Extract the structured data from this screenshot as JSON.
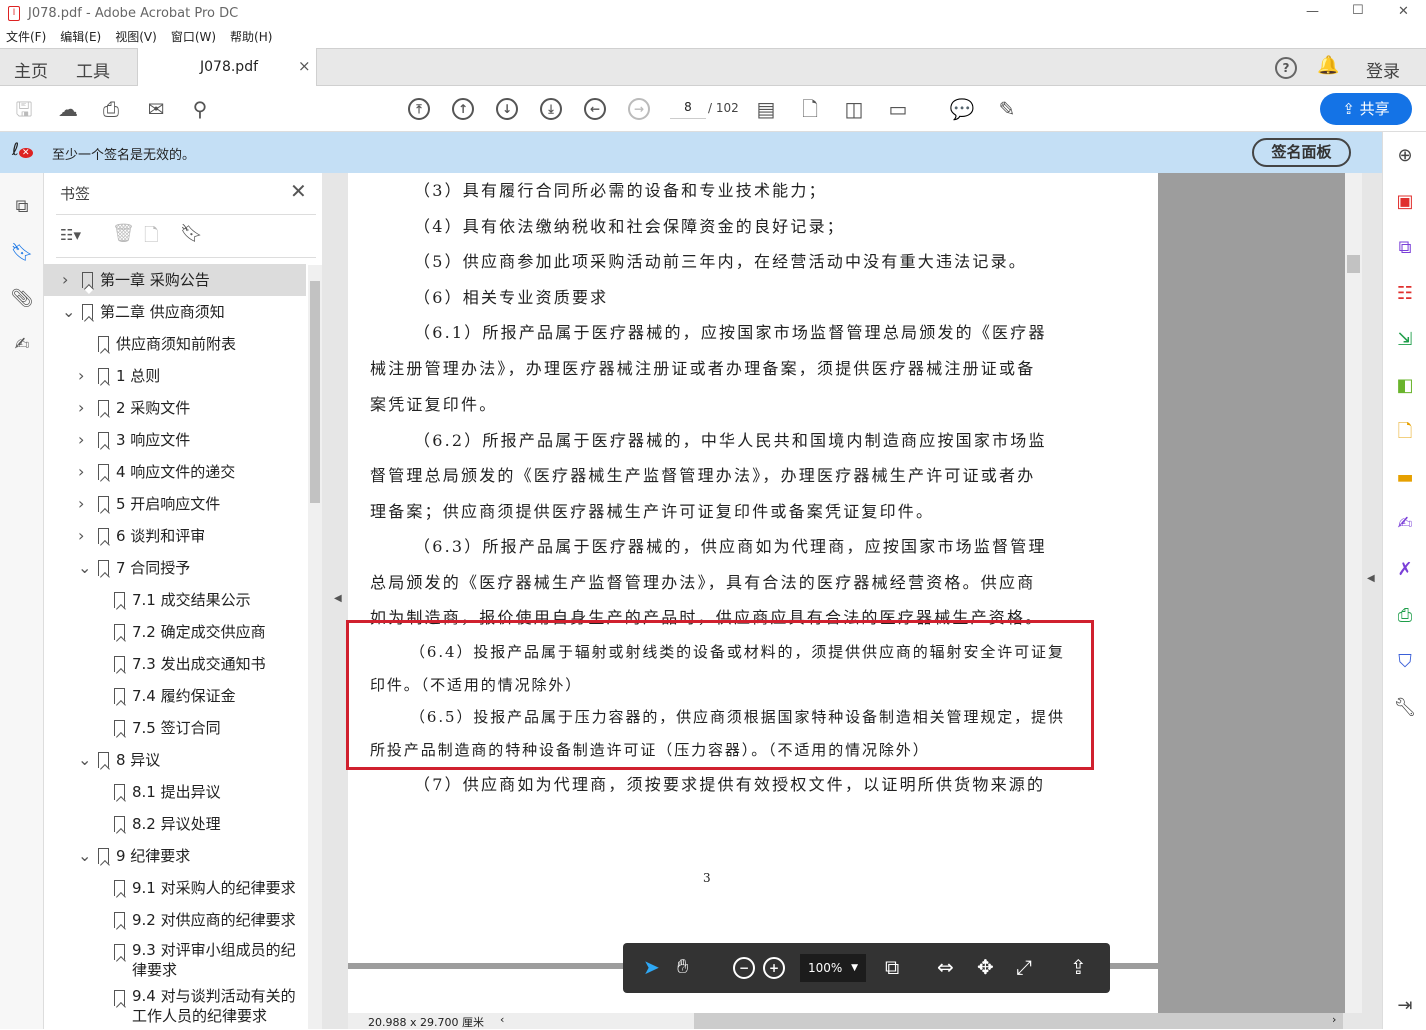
{
  "window": {
    "title": "J078.pdf - Adobe Acrobat Pro DC",
    "minimize": "—",
    "maximize": "☐",
    "close": "✕"
  },
  "menu": [
    "文件(F)",
    "编辑(E)",
    "视图(V)",
    "窗口(W)",
    "帮助(H)"
  ],
  "tabs": {
    "home": "主页",
    "tools": "工具",
    "doc": "J078.pdf",
    "close": "×",
    "login": "登录"
  },
  "toolbar": {
    "page_current": "8",
    "page_total": "/ 102",
    "share": "共享"
  },
  "notification": {
    "text": "至少一个签名是无效的。",
    "button": "签名面板"
  },
  "bookmarks": {
    "title": "书签",
    "items": [
      {
        "label": "第一章 采购公告",
        "level": 0,
        "chev": "›",
        "selected": true
      },
      {
        "label": "第二章 供应商须知",
        "level": 0,
        "chev": "⌄"
      },
      {
        "label": "供应商须知前附表",
        "level": 1,
        "chev": ""
      },
      {
        "label": "1 总则",
        "level": 1,
        "chev": "›"
      },
      {
        "label": "2 采购文件",
        "level": 1,
        "chev": "›"
      },
      {
        "label": "3 响应文件",
        "level": 1,
        "chev": "›"
      },
      {
        "label": "4 响应文件的递交",
        "level": 1,
        "chev": "›"
      },
      {
        "label": "5 开启响应文件",
        "level": 1,
        "chev": "›"
      },
      {
        "label": "6 谈判和评审",
        "level": 1,
        "chev": "›"
      },
      {
        "label": "7 合同授予",
        "level": 1,
        "chev": "⌄"
      },
      {
        "label": "7.1 成交结果公示",
        "level": 2,
        "chev": ""
      },
      {
        "label": "7.2 确定成交供应商",
        "level": 2,
        "chev": ""
      },
      {
        "label": "7.3 发出成交通知书",
        "level": 2,
        "chev": ""
      },
      {
        "label": "7.4 履约保证金",
        "level": 2,
        "chev": ""
      },
      {
        "label": "7.5 签订合同",
        "level": 2,
        "chev": ""
      },
      {
        "label": "8 异议",
        "level": 1,
        "chev": "⌄"
      },
      {
        "label": "8.1 提出异议",
        "level": 2,
        "chev": ""
      },
      {
        "label": "8.2 异议处理",
        "level": 2,
        "chev": ""
      },
      {
        "label": "9 纪律要求",
        "level": 1,
        "chev": "⌄"
      },
      {
        "label": "9.1 对采购人的纪律要求",
        "level": 2,
        "chev": ""
      },
      {
        "label": "9.2 对供应商的纪律要求",
        "level": 2,
        "chev": ""
      },
      {
        "label": "9.3 对评审小组成员的纪律要求",
        "level": 2,
        "chev": "",
        "wrap": [
          "9.3 对评审小组成员的纪",
          "律要求"
        ]
      },
      {
        "label": "9.4 对与谈判活动有关的工作人员的纪律要求",
        "level": 2,
        "chev": "",
        "wrap": [
          "9.4 对与谈判活动有关的",
          "工作人员的纪律要求"
        ]
      }
    ]
  },
  "document": {
    "lines": [
      {
        "t": "（3）具有履行合同所必需的设备和专业技术能力；",
        "i": 1
      },
      {
        "t": "（4）具有依法缴纳税收和社会保障资金的良好记录；",
        "i": 1
      },
      {
        "t": "（5）供应商参加此项采购活动前三年内，在经营活动中没有重大违法记录。",
        "i": 1
      },
      {
        "t": "（6）相关专业资质要求",
        "i": 1
      },
      {
        "t": "（6.1）所报产品属于医疗器械的，应按国家市场监督管理总局颁发的《医疗器",
        "i": 1
      },
      {
        "t": "械注册管理办法》，办理医疗器械注册证或者办理备案，须提供医疗器械注册证或备",
        "i": 0
      },
      {
        "t": "案凭证复印件。",
        "i": 0
      },
      {
        "t": "（6.2）所报产品属于医疗器械的，中华人民共和国境内制造商应按国家市场监",
        "i": 1
      },
      {
        "t": "督管理总局颁发的《医疗器械生产监督管理办法》，办理医疗器械生产许可证或者办",
        "i": 0
      },
      {
        "t": "理备案；供应商须提供医疗器械生产许可证复印件或备案凭证复印件。",
        "i": 0
      },
      {
        "t": "（6.3）所报产品属于医疗器械的，供应商如为代理商，应按国家市场监督管理",
        "i": 1
      },
      {
        "t": "总局颁发的《医疗器械生产监督管理办法》，具有合法的医疗器械经营资格。供应商",
        "i": 0
      },
      {
        "t": "如为制造商，报价使用自身生产的产品时，供应商应具有合法的医疗器械生产资格。",
        "i": 0
      },
      {
        "t": "（6.4）投报产品属于辐射或射线类的设备或材料的，须提供供应商的辐射安全许可证复",
        "i": 1,
        "s": 1
      },
      {
        "t": "印件。（不适用的情况除外）",
        "i": 0,
        "s": 1
      },
      {
        "t": "（6.5）投报产品属于压力容器的，供应商须根据国家特种设备制造相关管理规定，提供",
        "i": 1,
        "s": 1
      },
      {
        "t": "所投产品制造商的特种设备制造许可证（压力容器）。（不适用的情况除外）",
        "i": 0,
        "s": 1
      },
      {
        "t": "（7）供应商如为代理商，须按要求提供有效授权文件，以证明所供货物来源的",
        "i": 1
      }
    ],
    "page_number": "3",
    "highlight_color": "#d0202e"
  },
  "floatbar": {
    "zoom": "100%"
  },
  "status": {
    "page_size": "20.988 x 29.700 厘米"
  },
  "colors": {
    "accent": "#1473e6",
    "notif_bg": "#c4dff5"
  }
}
